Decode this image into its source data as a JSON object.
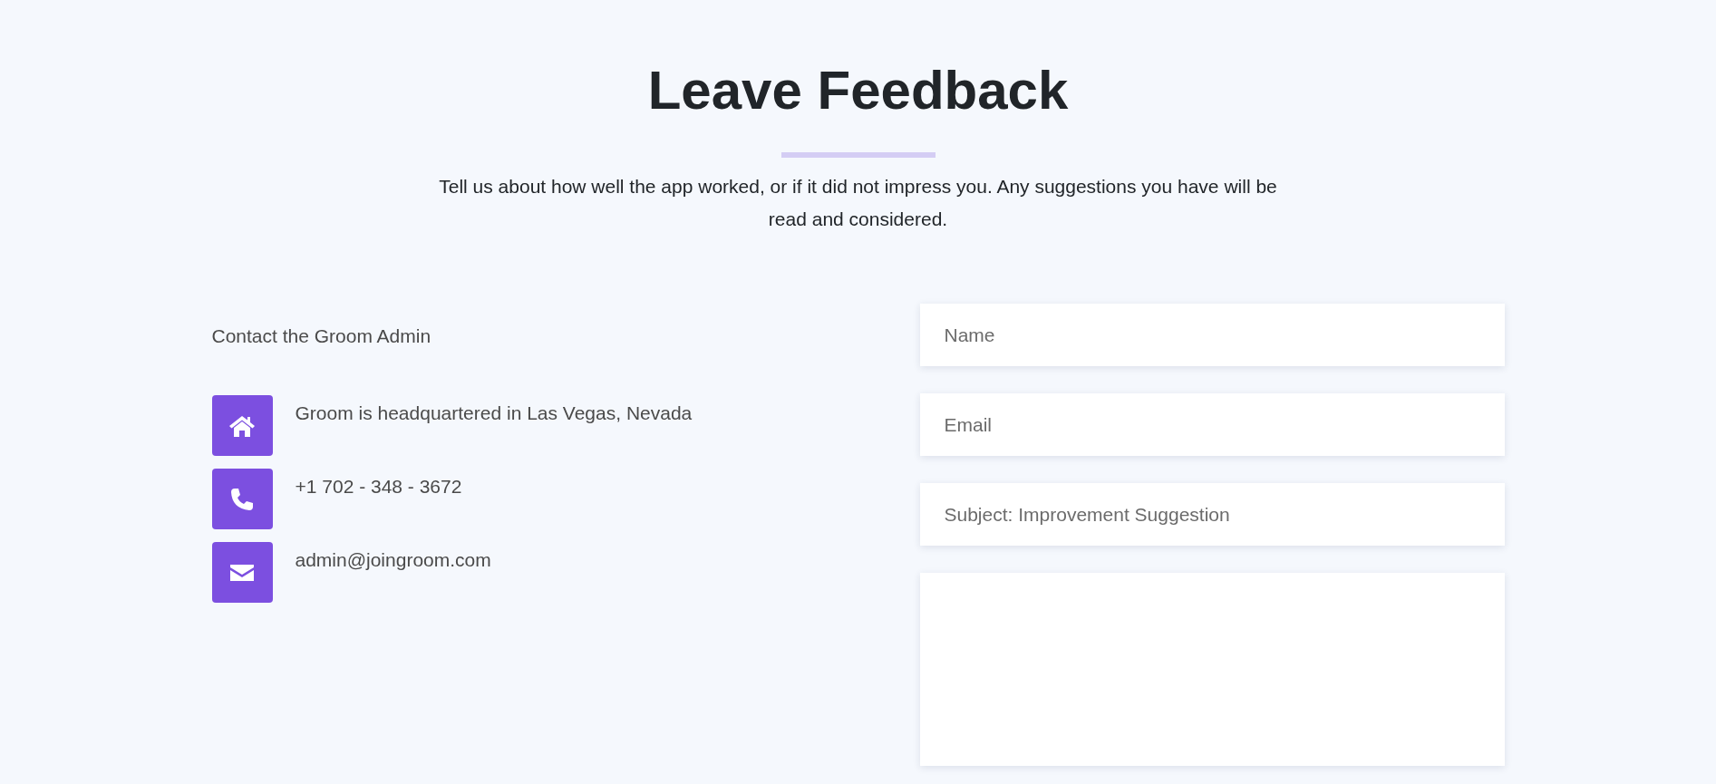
{
  "header": {
    "title": "Leave Feedback",
    "intro": "Tell us about how well the app worked, or if it did not impress you. Any suggestions you have will be read and considered."
  },
  "contact": {
    "heading": "Contact the Groom Admin",
    "items": [
      {
        "kind": "home",
        "text": "Groom is headquartered in Las Vegas, Nevada"
      },
      {
        "kind": "phone",
        "text": "+1 702 - 348 - 3672"
      },
      {
        "kind": "mail",
        "text": "admin@joingroom.com"
      }
    ]
  },
  "form": {
    "fields": [
      {
        "kind": "input",
        "placeholder": "Name"
      },
      {
        "kind": "input",
        "placeholder": "Email"
      },
      {
        "kind": "input",
        "placeholder": "Subject: Improvement Suggestion"
      },
      {
        "kind": "textarea"
      }
    ]
  }
}
